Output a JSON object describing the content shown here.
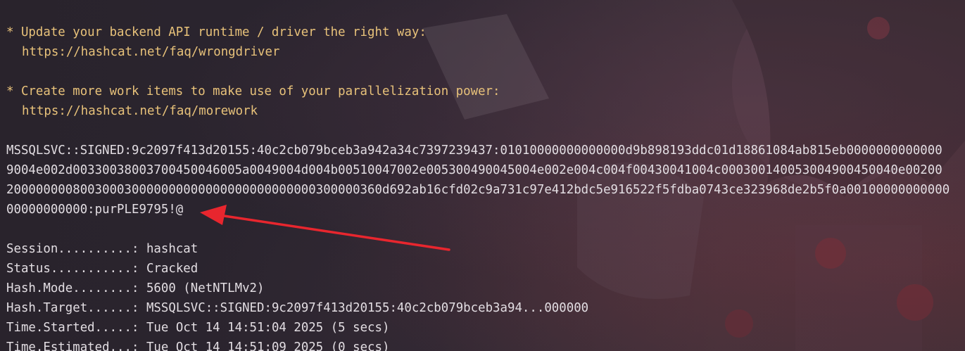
{
  "tips": [
    {
      "bullet": "* Update your backend API runtime / driver the right way:",
      "url": "https://hashcat.net/faq/wrongdriver"
    },
    {
      "bullet": "* Create more work items to make use of your parallelization power:",
      "url": "https://hashcat.net/faq/morework"
    }
  ],
  "hash_lines": [
    "MSSQLSVC::SIGNED:9c2097f413d20155:40c2cb079bceb3a942a34c7397239437:01010000000000000d9b898193ddc01d18861084ab815eb0000000000000",
    "9004e002d00330038003700450046005a0049004d004b00510047002e005300490045004e002e004c004f00430041004c000300140053004900450040e00200",
    "200000000800300030000000000000000000000000300000360d692ab16cfd02c9a731c97e412bdc5e916522f5fdba0743ce323968de2b5f0a00100000000000",
    "00000000000:purPLE9795!@"
  ],
  "status": {
    "session": {
      "label": "Session..........:",
      "value": "hashcat"
    },
    "status": {
      "label": "Status...........:",
      "value": "Cracked"
    },
    "hash_mode": {
      "label": "Hash.Mode........:",
      "value": "5600 (NetNTLMv2)"
    },
    "hash_target": {
      "label": "Hash.Target......:",
      "value": "MSSQLSVC::SIGNED:9c2097f413d20155:40c2cb079bceb3a94...000000"
    },
    "time_started": {
      "label": "Time.Started.....:",
      "value": "Tue Oct 14 14:51:04 2025 (5 secs)"
    },
    "time_estimated": {
      "label": "Time.Estimated...:",
      "value": "Tue Oct 14 14:51:09 2025 (0 secs)"
    }
  },
  "colors": {
    "tip_text": "#e8c27a",
    "output_text": "#e2dde2",
    "annotation_arrow": "#e8262e"
  },
  "icons": {
    "annotation": "red-arrow-icon"
  }
}
